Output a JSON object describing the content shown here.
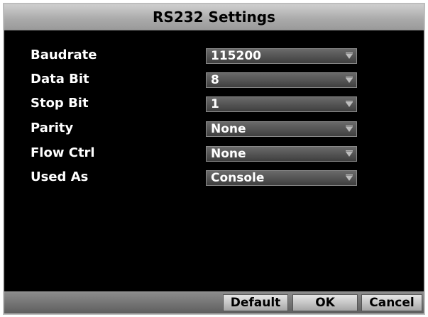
{
  "window": {
    "title": "RS232 Settings"
  },
  "fields": [
    {
      "label": "Baudrate",
      "value": "115200"
    },
    {
      "label": "Data Bit",
      "value": "8"
    },
    {
      "label": "Stop Bit",
      "value": "1"
    },
    {
      "label": "Parity",
      "value": "None"
    },
    {
      "label": "Flow Ctrl",
      "value": "None"
    },
    {
      "label": "Used As",
      "value": "Console"
    }
  ],
  "buttons": {
    "default_label": "Default",
    "ok_label": "OK",
    "cancel_label": "Cancel"
  },
  "icons": {
    "dropdown": "chevron-down-icon"
  },
  "colors": {
    "background": "#000000",
    "title_bar": "#b5b5b5",
    "text": "#ffffff",
    "field": "#4a4a4a"
  }
}
